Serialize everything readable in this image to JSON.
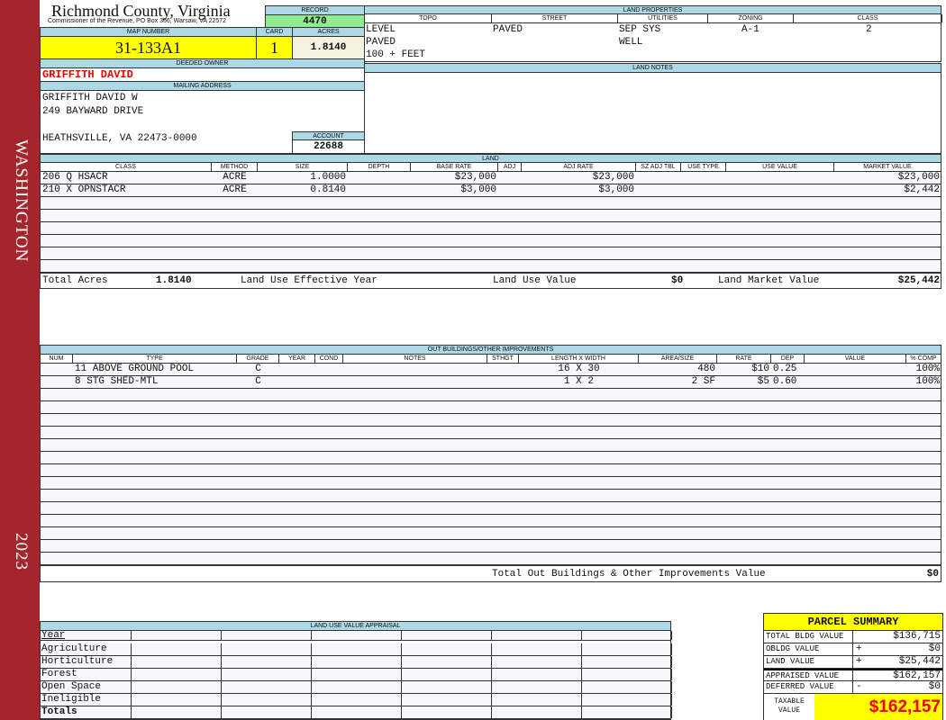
{
  "sidebar": {
    "district": "WASHINGTON",
    "year": "2023",
    "color": "#a4262c"
  },
  "header": {
    "county": "Richmond County, Virginia",
    "subtitle": "Commissioner of the Revenue, PO Box 366, Warsaw, VA 22572"
  },
  "record": {
    "label": "RECORD",
    "value": "4470"
  },
  "map": {
    "label": "MAP NUMBER",
    "value": "31-133A1"
  },
  "card": {
    "label": "CARD",
    "value": "1"
  },
  "acres": {
    "label": "ACRES",
    "value": "1.8140"
  },
  "owner": {
    "label": "DEEDED OWNER",
    "value": "GRIFFITH DAVID"
  },
  "mailing": {
    "label": "MAILING ADDRESS",
    "line1": "GRIFFITH DAVID W",
    "line2": "249 BAYWARD DRIVE",
    "line3": "HEATHSVILLE, VA 22473-0000"
  },
  "account": {
    "label": "ACCOUNT",
    "value": "22688"
  },
  "land_properties": {
    "label": "LAND PROPERTIES",
    "columns": [
      "TOPO",
      "STREET",
      "UTILITIES",
      "ZONING",
      "CLASS"
    ],
    "topo": [
      "LEVEL",
      "PAVED",
      "100 + FEET"
    ],
    "street": [
      "PAVED"
    ],
    "utilities": [
      "SEP SYS",
      "WELL"
    ],
    "zoning": "A-1",
    "class": "2"
  },
  "land_notes": {
    "label": "LAND NOTES"
  },
  "land": {
    "label": "LAND",
    "columns": [
      "CLASS",
      "METHOD",
      "SIZE",
      "DEPTH",
      "BASE RATE",
      "ADJ",
      "ADJ RATE",
      "SZ ADJ TBL",
      "USE TYPE",
      "USE VALUE",
      "MARKET VALUE"
    ],
    "rows": [
      [
        "206 Q HSACR",
        "ACRE",
        "1.0000",
        "",
        "$23,000",
        "",
        "$23,000",
        "",
        "",
        "",
        "$23,000"
      ],
      [
        "210 X OPNSTACR",
        "ACRE",
        "0.8140",
        "",
        "$3,000",
        "",
        "$3,000",
        "",
        "",
        "",
        "$2,442"
      ]
    ],
    "totals": {
      "total_acres_label": "Total Acres",
      "total_acres": "1.8140",
      "effective_year_label": "Land Use Effective Year",
      "use_value_label": "Land Use Value",
      "use_value": "$0",
      "market_value_label": "Land Market Value",
      "market_value": "$25,442"
    }
  },
  "outbuildings": {
    "label": "OUT BUILDINGS/OTHER IMPROVEMENTS",
    "columns": [
      "NUM",
      "TYPE",
      "GRADE",
      "YEAR",
      "COND",
      "NOTES",
      "STHGT",
      "LENGTH X WIDTH",
      "AREA/SIZE",
      "RATE",
      "DEP",
      "VALUE",
      "% COMP"
    ],
    "rows": [
      [
        "",
        "11 ABOVE GROUND POOL",
        "C",
        "",
        "",
        "",
        "",
        "16 X 30",
        "480",
        "$10",
        "0.25",
        "",
        "100%"
      ],
      [
        "",
        "8 STG SHED-MTL",
        "C",
        "",
        "",
        "",
        "",
        "1 X 2",
        "2 SF",
        "$5",
        "0.60",
        "",
        "100%"
      ]
    ],
    "total_label": "Total Out Buildings & Other Improvements Value",
    "total": "$0"
  },
  "land_use_appraisal": {
    "label": "LAND USE VALUE APPRAISAL",
    "year_label": "Year",
    "rows": [
      "Agriculture",
      "Horticulture",
      "Forest",
      "Open Space",
      "Ineligible"
    ],
    "totals_label": "Totals"
  },
  "parcel_summary": {
    "title": "PARCEL SUMMARY",
    "rows": [
      {
        "label": "TOTAL BLDG VALUE",
        "sign": "",
        "value": "$136,715"
      },
      {
        "label": "OBLDG VALUE",
        "sign": "+",
        "value": "$0"
      },
      {
        "label": "LAND VALUE",
        "sign": "+",
        "value": "$25,442"
      },
      {
        "label": "APPRAISED VALUE",
        "sign": "",
        "value": "$162,157"
      },
      {
        "label": "DEFERRED VALUE",
        "sign": "-",
        "value": "$0"
      }
    ],
    "taxable_label": "TAXABLE VALUE",
    "taxable": "$162,157"
  }
}
